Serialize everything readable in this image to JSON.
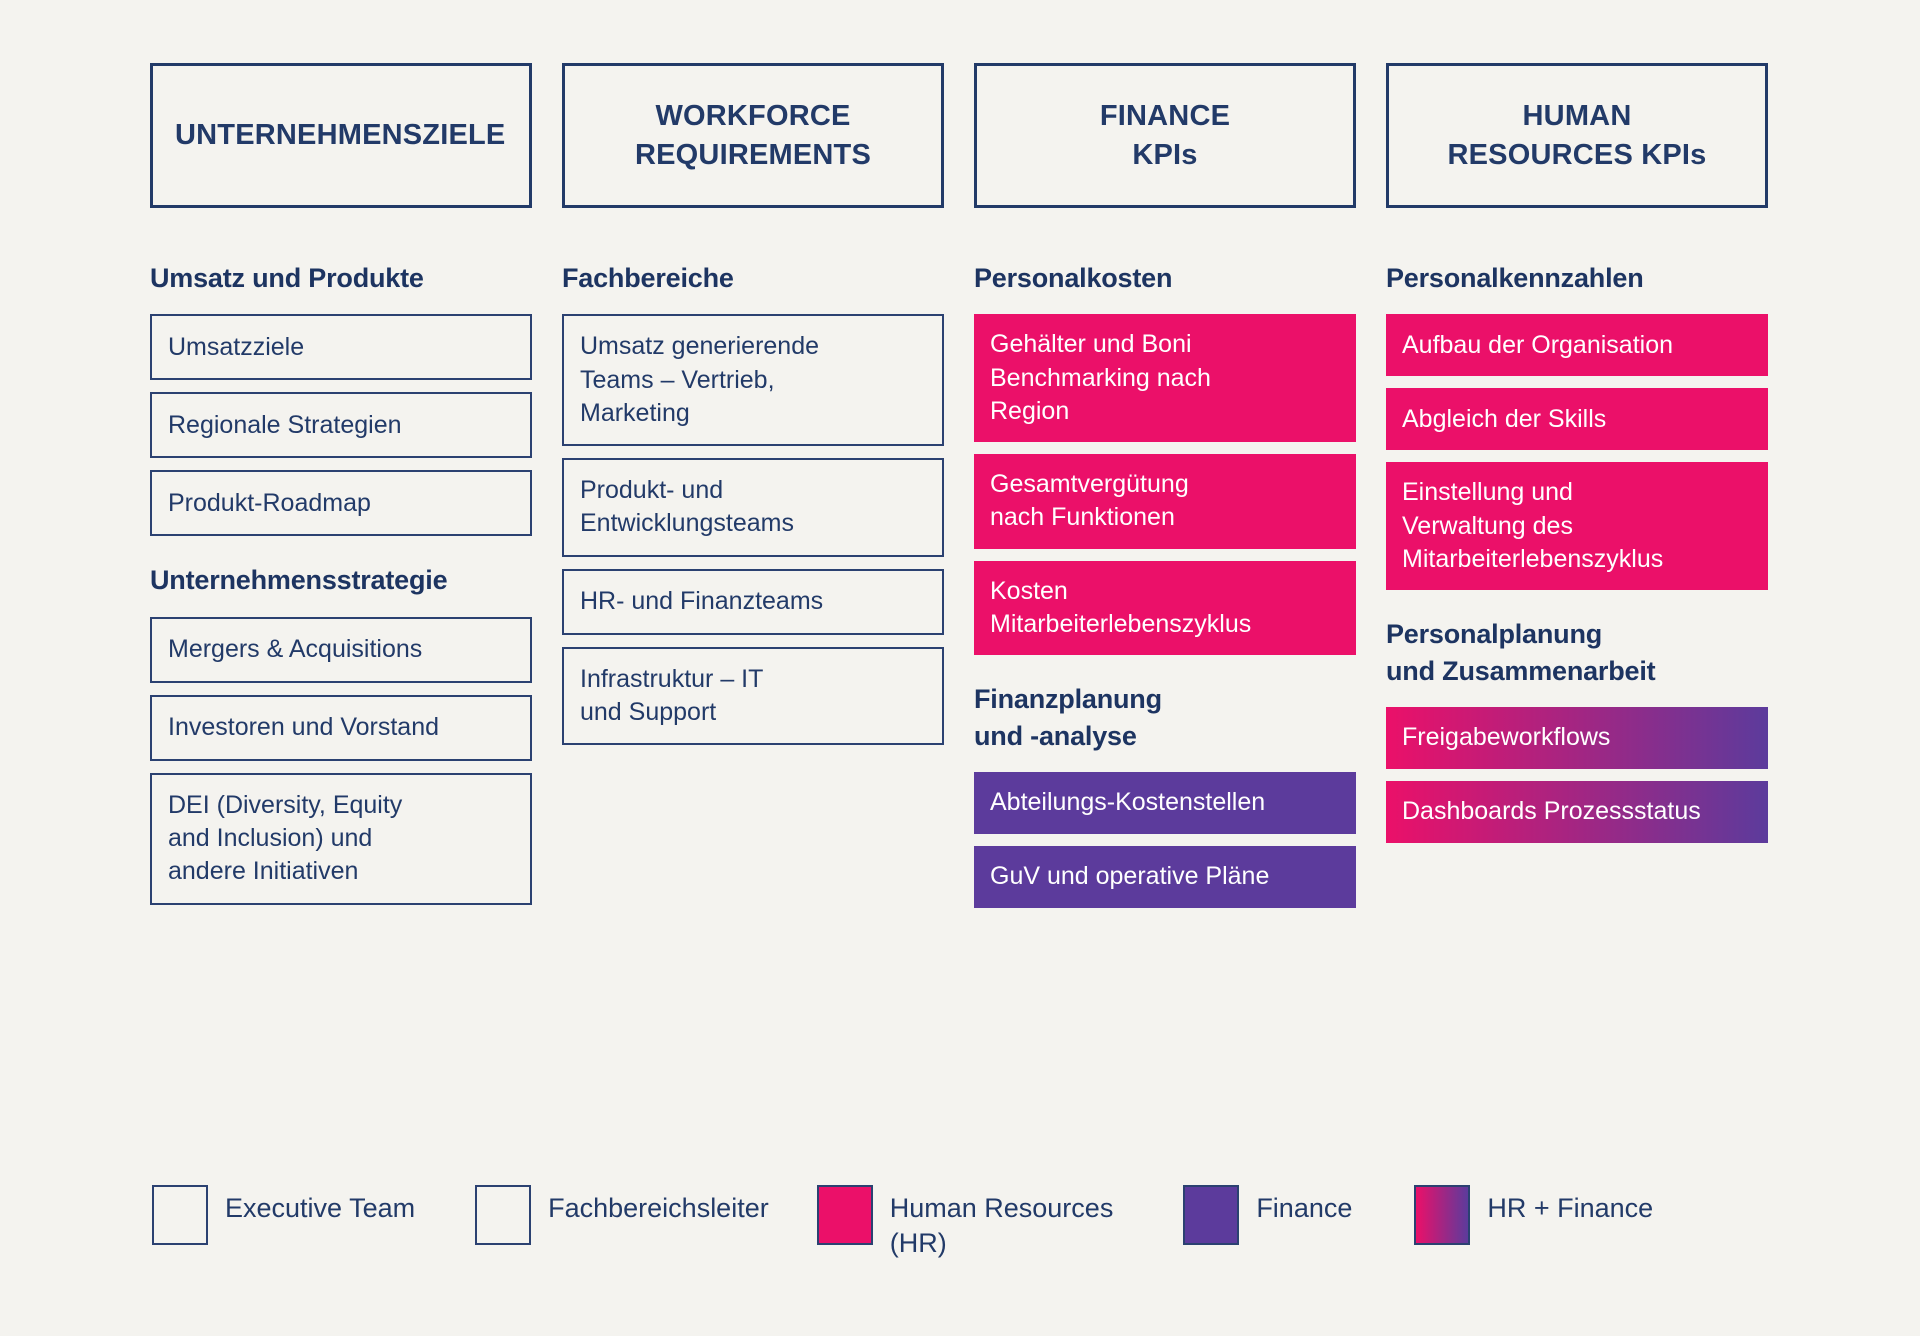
{
  "theme": {
    "background": "#f4f3ef",
    "navy": "#223a68",
    "pink": "#eb1069",
    "purple": "#5c3b9c"
  },
  "columns": [
    {
      "header": "UNTERNEHMENSZIELE",
      "header_align": "left",
      "sections": [
        {
          "title": "Umsatz und Produkte",
          "items": [
            {
              "label": "Umsatzziele",
              "style": "outline"
            },
            {
              "label": "Regionale Strategien",
              "style": "outline"
            },
            {
              "label": "Produkt-Roadmap",
              "style": "outline"
            }
          ]
        },
        {
          "title": "Unternehmensstrategie",
          "items": [
            {
              "label": "Mergers & Acquisitions",
              "style": "outline"
            },
            {
              "label": "Investoren und Vorstand",
              "style": "outline"
            },
            {
              "label": "DEI (Diversity, Equity\nand Inclusion) und\nandere Initiativen",
              "style": "outline"
            }
          ]
        }
      ]
    },
    {
      "header": "WORKFORCE\nREQUIREMENTS",
      "header_align": "center",
      "sections": [
        {
          "title": "Fachbereiche",
          "items": [
            {
              "label": "Umsatz generierende\nTeams – Vertrieb,\nMarketing",
              "style": "outline"
            },
            {
              "label": "Produkt- und\nEntwicklungsteams",
              "style": "outline"
            },
            {
              "label": "HR- und Finanzteams",
              "style": "outline"
            },
            {
              "label": "Infrastruktur – IT\nund Support",
              "style": "outline"
            }
          ]
        }
      ]
    },
    {
      "header": "FINANCE\nKPIs",
      "header_align": "center",
      "sections": [
        {
          "title": "Personalkosten",
          "items": [
            {
              "label": "Gehälter und Boni\nBenchmarking nach\nRegion",
              "style": "pink"
            },
            {
              "label": "Gesamtvergütung\nnach Funktionen",
              "style": "pink"
            },
            {
              "label": "Kosten\nMitarbeiterlebenszyklus",
              "style": "pink"
            }
          ]
        },
        {
          "title": "Finanzplanung\nund -analyse",
          "items": [
            {
              "label": "Abteilungs-Kostenstellen",
              "style": "purple"
            },
            {
              "label": "GuV und operative Pläne",
              "style": "purple"
            }
          ]
        }
      ]
    },
    {
      "header": "HUMAN\nRESOURCES KPIs",
      "header_align": "center",
      "sections": [
        {
          "title": "Personalkennzahlen",
          "items": [
            {
              "label": "Aufbau der Organisation",
              "style": "pink"
            },
            {
              "label": "Abgleich der Skills",
              "style": "pink"
            },
            {
              "label": "Einstellung und\nVerwaltung des\nMitarbeiterlebenszyklus",
              "style": "pink"
            }
          ]
        },
        {
          "title": "Personalplanung\nund Zusammenarbeit",
          "items": [
            {
              "label": "Freigabeworkflows",
              "style": "gradient"
            },
            {
              "label": "Dashboards Prozessstatus",
              "style": "gradient"
            }
          ]
        }
      ]
    }
  ],
  "legend": [
    {
      "label": "Executive Team",
      "style": "outline",
      "gap_after": 60
    },
    {
      "label": "Fachbereichsleiter",
      "style": "outline",
      "gap_after": 48
    },
    {
      "label": "Human Resources\n(HR)",
      "style": "pink",
      "gap_after": 70
    },
    {
      "label": "Finance",
      "style": "purple",
      "gap_after": 62
    },
    {
      "label": "HR + Finance",
      "style": "gradient",
      "gap_after": 0
    }
  ]
}
